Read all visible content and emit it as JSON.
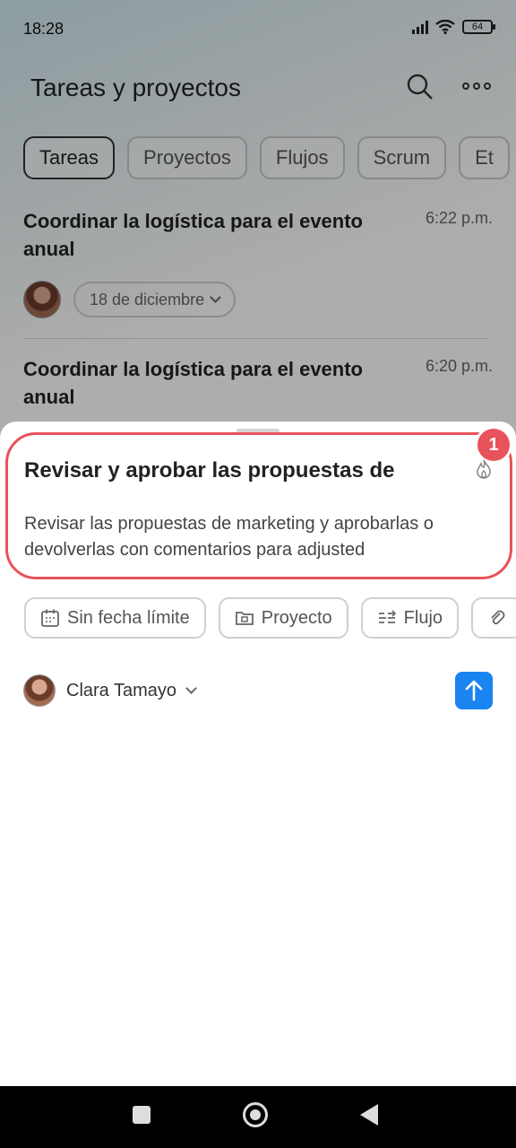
{
  "status_bar": {
    "time": "18:28",
    "battery": "64"
  },
  "header": {
    "title": "Tareas y proyectos",
    "search_icon": "search-icon",
    "more_icon": "more-icon"
  },
  "tabs": [
    {
      "label": "Tareas",
      "active": true
    },
    {
      "label": "Proyectos"
    },
    {
      "label": "Flujos"
    },
    {
      "label": "Scrum"
    },
    {
      "label": "Et"
    }
  ],
  "tasks": [
    {
      "title": "Coordinar la logística para el evento anual",
      "time": "6:22 p.m.",
      "date": "18 de diciembre"
    },
    {
      "title": "Coordinar la logística para el evento anual",
      "time": "6:20 p.m."
    }
  ],
  "sheet": {
    "badge": "1",
    "title": "Revisar y aprobar las propuestas de",
    "description": "Revisar las propuestas de marketing y aprobarlas o devolverlas con comentarios para adjusted",
    "chips": [
      {
        "label": "Sin fecha límite",
        "icon": "calendar-icon"
      },
      {
        "label": "Proyecto",
        "icon": "folder-icon"
      },
      {
        "label": "Flujo",
        "icon": "flow-icon"
      }
    ],
    "assignee": "Clara Tamayo",
    "accent": "#1a84f0",
    "highlight_color": "#e8525a"
  }
}
